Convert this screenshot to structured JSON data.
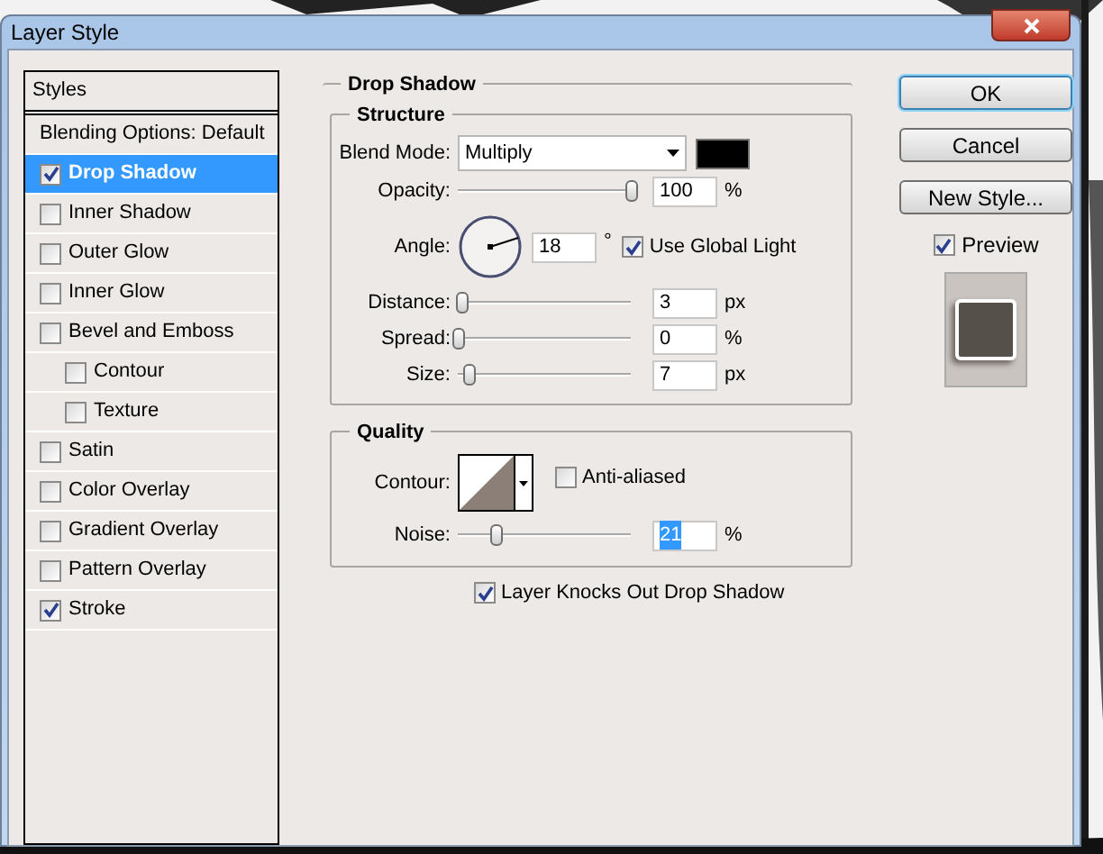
{
  "window": {
    "title": "Layer Style"
  },
  "sidebar": {
    "header": "Styles",
    "items": [
      {
        "label": "Blending Options: Default",
        "kind": "plain",
        "selected": false
      },
      {
        "label": "Drop Shadow",
        "kind": "check",
        "checked": true,
        "selected": true
      },
      {
        "label": "Inner Shadow",
        "kind": "check",
        "checked": false,
        "selected": false
      },
      {
        "label": "Outer Glow",
        "kind": "check",
        "checked": false,
        "selected": false
      },
      {
        "label": "Inner Glow",
        "kind": "check",
        "checked": false,
        "selected": false
      },
      {
        "label": "Bevel and Emboss",
        "kind": "check",
        "checked": false,
        "selected": false,
        "children": [
          {
            "label": "Contour",
            "kind": "check",
            "checked": false,
            "selected": false
          },
          {
            "label": "Texture",
            "kind": "check",
            "checked": false,
            "selected": false
          }
        ]
      },
      {
        "label": "Satin",
        "kind": "check",
        "checked": false,
        "selected": false
      },
      {
        "label": "Color Overlay",
        "kind": "check",
        "checked": false,
        "selected": false
      },
      {
        "label": "Gradient Overlay",
        "kind": "check",
        "checked": false,
        "selected": false
      },
      {
        "label": "Pattern Overlay",
        "kind": "check",
        "checked": false,
        "selected": false
      },
      {
        "label": "Stroke",
        "kind": "check",
        "checked": true,
        "selected": false
      }
    ]
  },
  "panel": {
    "title": "Drop Shadow",
    "structure": {
      "title": "Structure",
      "rows": [
        {
          "kind": "select",
          "label": "Blend Mode:",
          "value": "Multiply"
        },
        {
          "kind": "slider",
          "label": "Opacity:",
          "level": 1,
          "value": "100",
          "unit": "%"
        },
        {
          "kind": "angle",
          "label": "Angle:",
          "value": "18",
          "unit": "°",
          "checkbox": {
            "label": "Use Global Light",
            "checked": true
          }
        },
        {
          "kind": "slider",
          "label": "Distance:",
          "level": 0.02,
          "value": "3",
          "unit": "px"
        },
        {
          "kind": "slider",
          "label": "Spread:",
          "level": 0,
          "value": "0",
          "unit": "%"
        },
        {
          "kind": "slider",
          "label": "Size:",
          "level": 0.06,
          "value": "7",
          "unit": "px"
        }
      ]
    },
    "quality": {
      "title": "Quality",
      "contour_label": "Contour:",
      "anti_aliased": {
        "label": "Anti-aliased",
        "checked": false
      },
      "noise": {
        "label": "Noise:",
        "level": 0.22,
        "value": "21",
        "unit": "%",
        "highlighted": true
      }
    },
    "knockout": {
      "label": "Layer Knocks Out Drop Shadow",
      "checked": true
    }
  },
  "buttons": [
    {
      "label": "OK",
      "default": true
    },
    {
      "label": "Cancel",
      "default": false
    },
    {
      "label": "New Style...",
      "default": false
    }
  ],
  "preview": {
    "label": "Preview",
    "checked": true
  }
}
